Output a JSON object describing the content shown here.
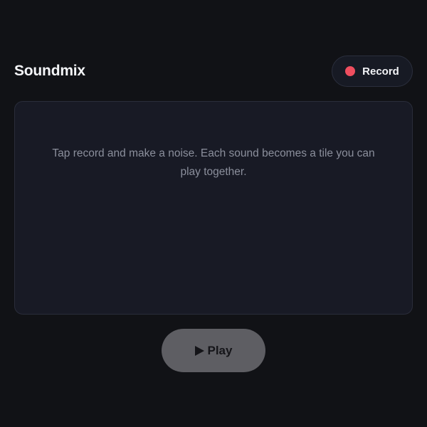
{
  "app": {
    "title": "Soundmix"
  },
  "header": {
    "record_label": "Record"
  },
  "tiles": {
    "empty_message": "Tap record and make a noise. Each sound becomes a tile you can play together."
  },
  "controls": {
    "play_label": "Play"
  },
  "icons": {
    "record": "record-dot-icon",
    "play": "play-triangle-icon"
  },
  "colors": {
    "background": "#111216",
    "panel": "#181a25",
    "record_dot": "#ef4e5f",
    "play_button": "#5e5e63"
  }
}
